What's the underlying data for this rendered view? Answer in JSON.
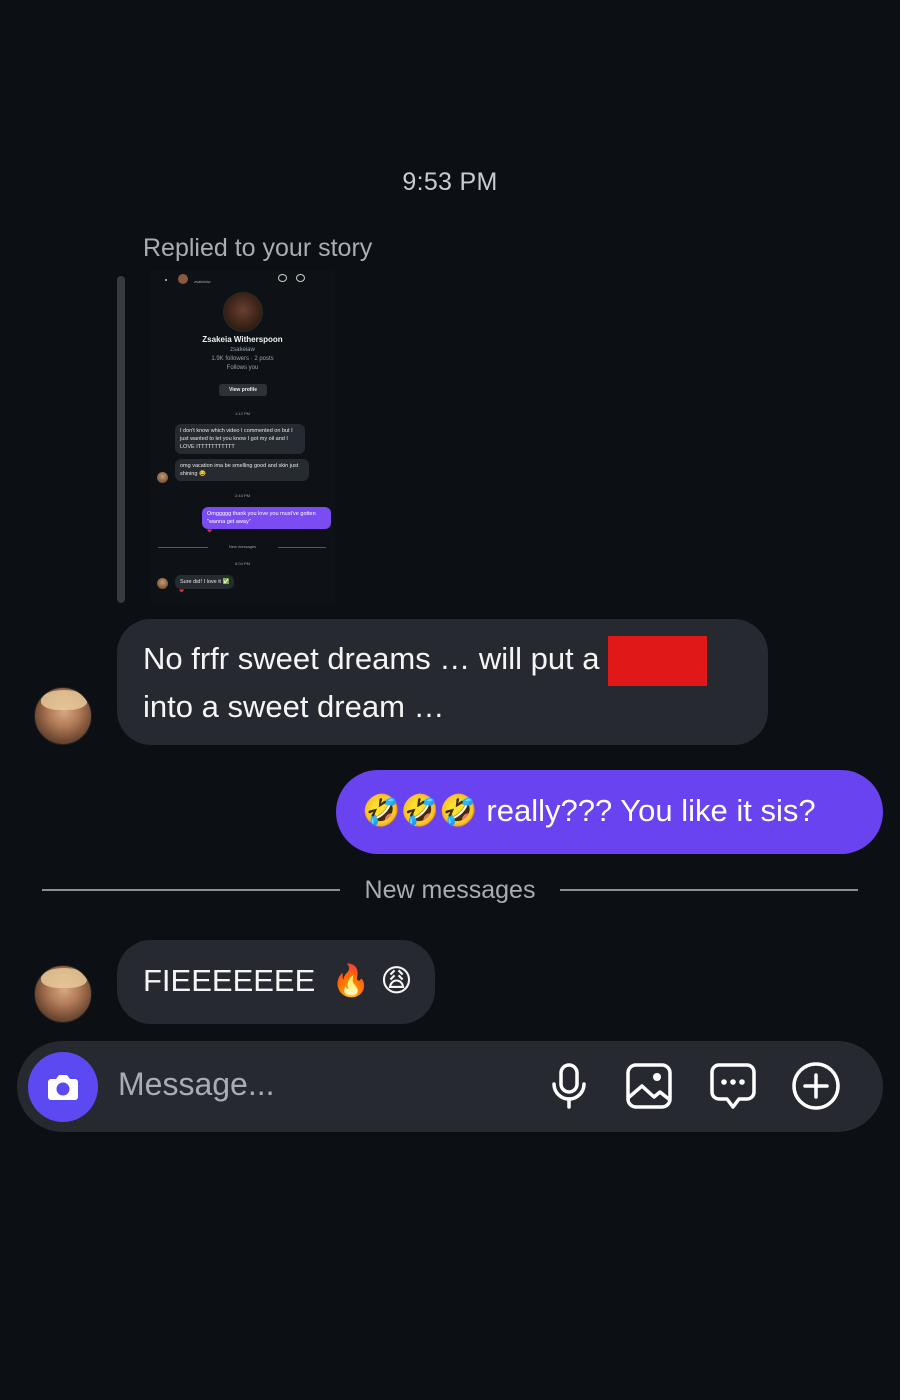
{
  "thread": {
    "time_header": "9:53 PM",
    "story_reply_label": "Replied to your story",
    "story_preview": {
      "profile_name": "Zsakeia Witherspoon",
      "username": "zsakeiaw",
      "stats": "1.9K followers · 2 posts",
      "follows_you": "Follows you",
      "view_profile": "View profile",
      "time1": "1:12 PM",
      "msg1": "I don't know which video I commented on but I just wanted to let you know I got my oil and I LOVE ITTTTTTTTTTT",
      "msg2": "omg vacation ima be smelling good and skin just shining 😂",
      "time2": "2:44 PM",
      "msg3": "Omggggg thank you love you must've gotten \"wanna get away\"",
      "new_messages": "New messages",
      "time3": "6:04 PM",
      "msg4": "Sure did! I love it ✅"
    },
    "messages": [
      {
        "direction": "incoming",
        "line1": "No frfr sweet dreams … will put a",
        "line2": "into a sweet dream …"
      },
      {
        "direction": "outgoing",
        "emojis": "🤣🤣🤣",
        "text": "really??? You like it sis?"
      },
      {
        "direction": "incoming",
        "text": "FIEEEEEEE",
        "emojis": "🔥 😩"
      }
    ],
    "new_messages_divider": "New messages"
  },
  "composer": {
    "placeholder": "Message...",
    "icons": [
      "camera-icon",
      "microphone-icon",
      "gallery-icon",
      "sticker-chat-icon",
      "add-icon"
    ]
  },
  "colors": {
    "background": "#0c1014",
    "incoming_bubble": "#262a30",
    "outgoing_bubble": "#6a43f0",
    "camera_button": "#5b49f2",
    "redaction": "#e01818"
  }
}
